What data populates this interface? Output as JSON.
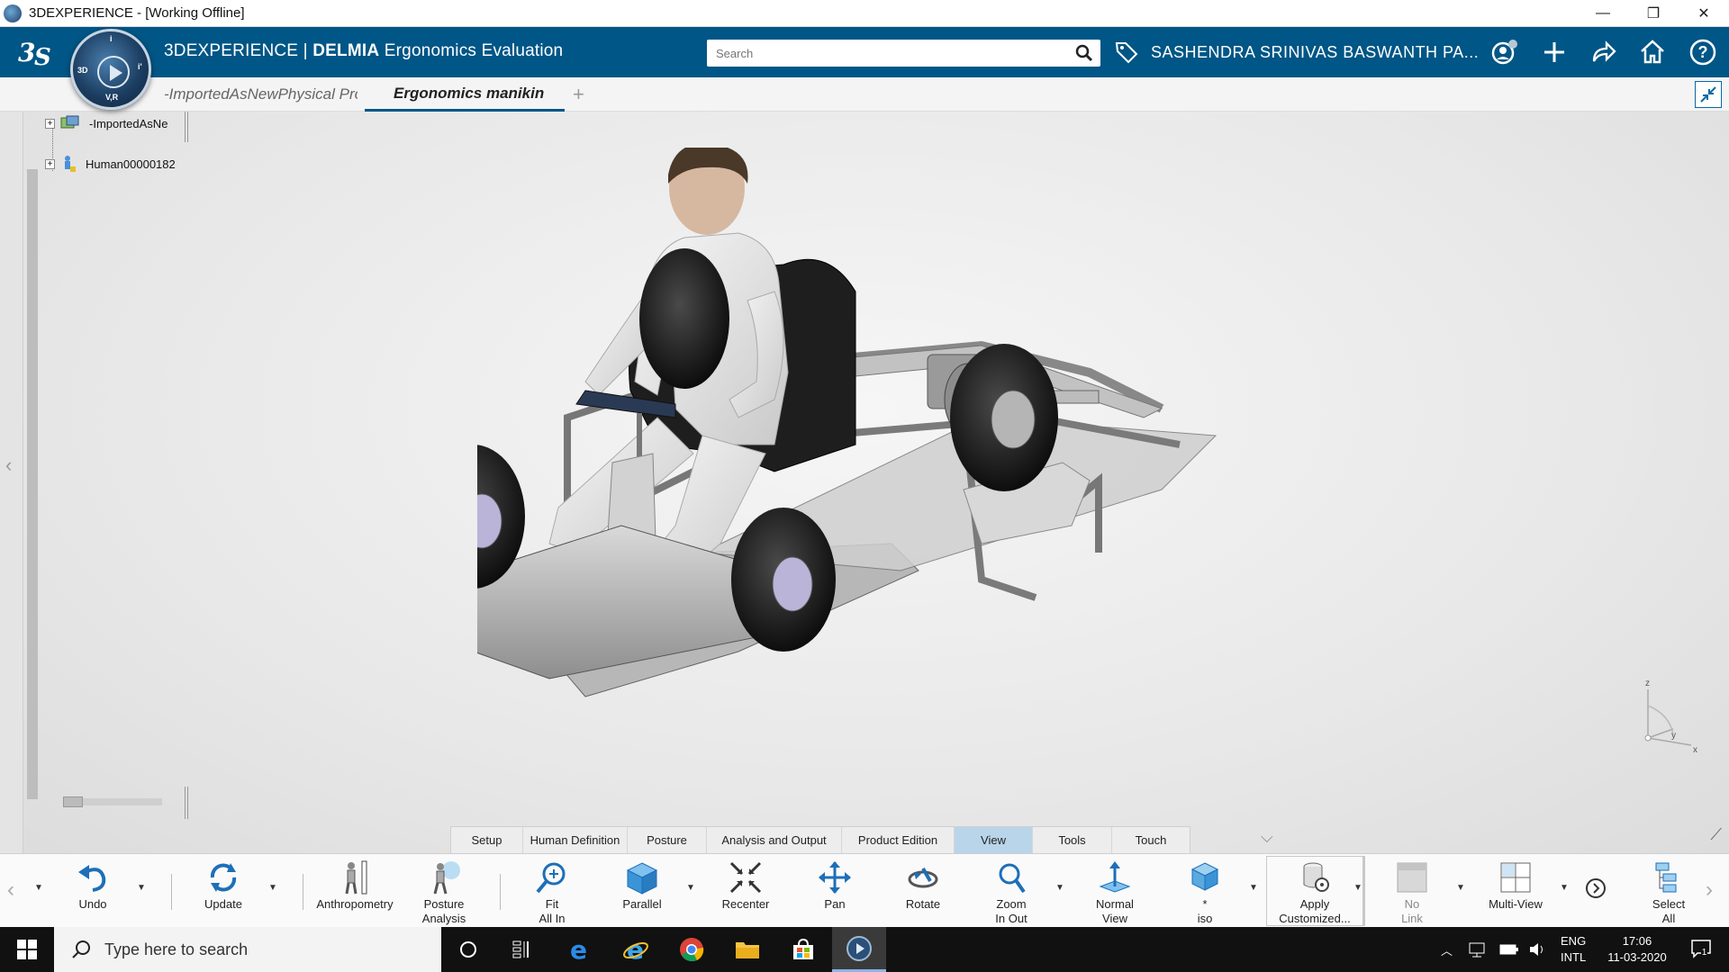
{
  "window": {
    "title": "3DEXPERIENCE - [Working Offline]",
    "minimize": "—",
    "restore": "❐",
    "close": "✕"
  },
  "header": {
    "brand_prefix": "3DEXPERIENCE | ",
    "brand_bold": "DELMIA",
    "brand_app": " Ergonomics Evaluation",
    "search_placeholder": "Search",
    "user_name": "SASHENDRA SRINIVAS BASWANTH PA...",
    "compass_labels": {
      "top": "i",
      "left": "3D",
      "right": "i'",
      "bottom": "V,R"
    }
  },
  "tabs": [
    {
      "label": "-ImportedAsNewPhysical Pro",
      "active": false
    },
    {
      "label": "Ergonomics manikin",
      "active": true
    }
  ],
  "tab_add": "+",
  "tree": {
    "nodes": [
      {
        "label": "-ImportedAsNe"
      },
      {
        "label": "Human00000182"
      }
    ]
  },
  "section_tabs": [
    {
      "label": "Setup",
      "active": false
    },
    {
      "label": "Human Definition",
      "active": false
    },
    {
      "label": "Posture",
      "active": false
    },
    {
      "label": "Analysis and Output",
      "active": false
    },
    {
      "label": "Product Edition",
      "active": false
    },
    {
      "label": "View",
      "active": true
    },
    {
      "label": "Tools",
      "active": false
    },
    {
      "label": "Touch",
      "active": false
    }
  ],
  "actions": {
    "undo": "Undo",
    "update": "Update",
    "anthropometry": "Anthropometry",
    "posture_analysis": "Posture\nAnalysis",
    "fit_all_in": "Fit\nAll In",
    "parallel": "Parallel",
    "recenter": "Recenter",
    "pan": "Pan",
    "rotate": "Rotate",
    "zoom_in_out": "Zoom\nIn Out",
    "normal_view": "Normal\nView",
    "iso": "*\niso",
    "apply_customized": "Apply\nCustomized...",
    "no_link": "No\nLink",
    "multi_view": "Multi-View",
    "select_all": "Select\nAll"
  },
  "compass3d": {
    "z": "z",
    "y": "y",
    "x": "x"
  },
  "taskbar": {
    "search_placeholder": "Type here to search",
    "lang_top": "ENG",
    "lang_bottom": "INTL",
    "time": "17:06",
    "date": "11-03-2020",
    "notification_count": "1"
  },
  "colors": {
    "header_bg": "#005686",
    "active_section_tab": "#b9d5ea",
    "taskbar_bg": "#111111"
  }
}
